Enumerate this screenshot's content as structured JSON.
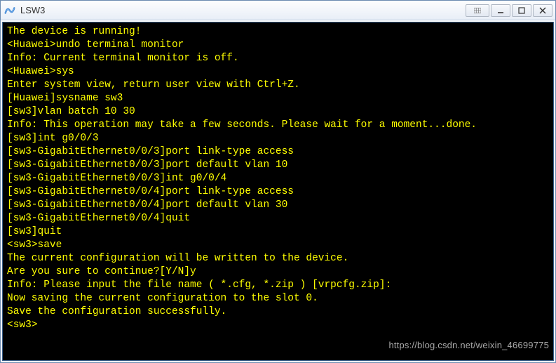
{
  "window": {
    "title": "LSW3"
  },
  "terminal": {
    "lines": [
      "The device is running!",
      "",
      "<Huawei>undo terminal monitor",
      "Info: Current terminal monitor is off.",
      "<Huawei>sys",
      "Enter system view, return user view with Ctrl+Z.",
      "[Huawei]sysname sw3",
      "[sw3]vlan batch 10 30",
      "Info: This operation may take a few seconds. Please wait for a moment...done.",
      "[sw3]int g0/0/3",
      "[sw3-GigabitEthernet0/0/3]port link-type access",
      "[sw3-GigabitEthernet0/0/3]port default vlan 10",
      "[sw3-GigabitEthernet0/0/3]int g0/0/4",
      "[sw3-GigabitEthernet0/0/4]port link-type access",
      "[sw3-GigabitEthernet0/0/4]port default vlan 30",
      "[sw3-GigabitEthernet0/0/4]quit",
      "[sw3]quit",
      "<sw3>save",
      "The current configuration will be written to the device.",
      "Are you sure to continue?[Y/N]y",
      "Info: Please input the file name ( *.cfg, *.zip ) [vrpcfg.zip]:",
      "Now saving the current configuration to the slot 0.",
      "Save the configuration successfully.",
      "<sw3>"
    ]
  },
  "watermark": "https://blog.csdn.net/weixin_46699775"
}
